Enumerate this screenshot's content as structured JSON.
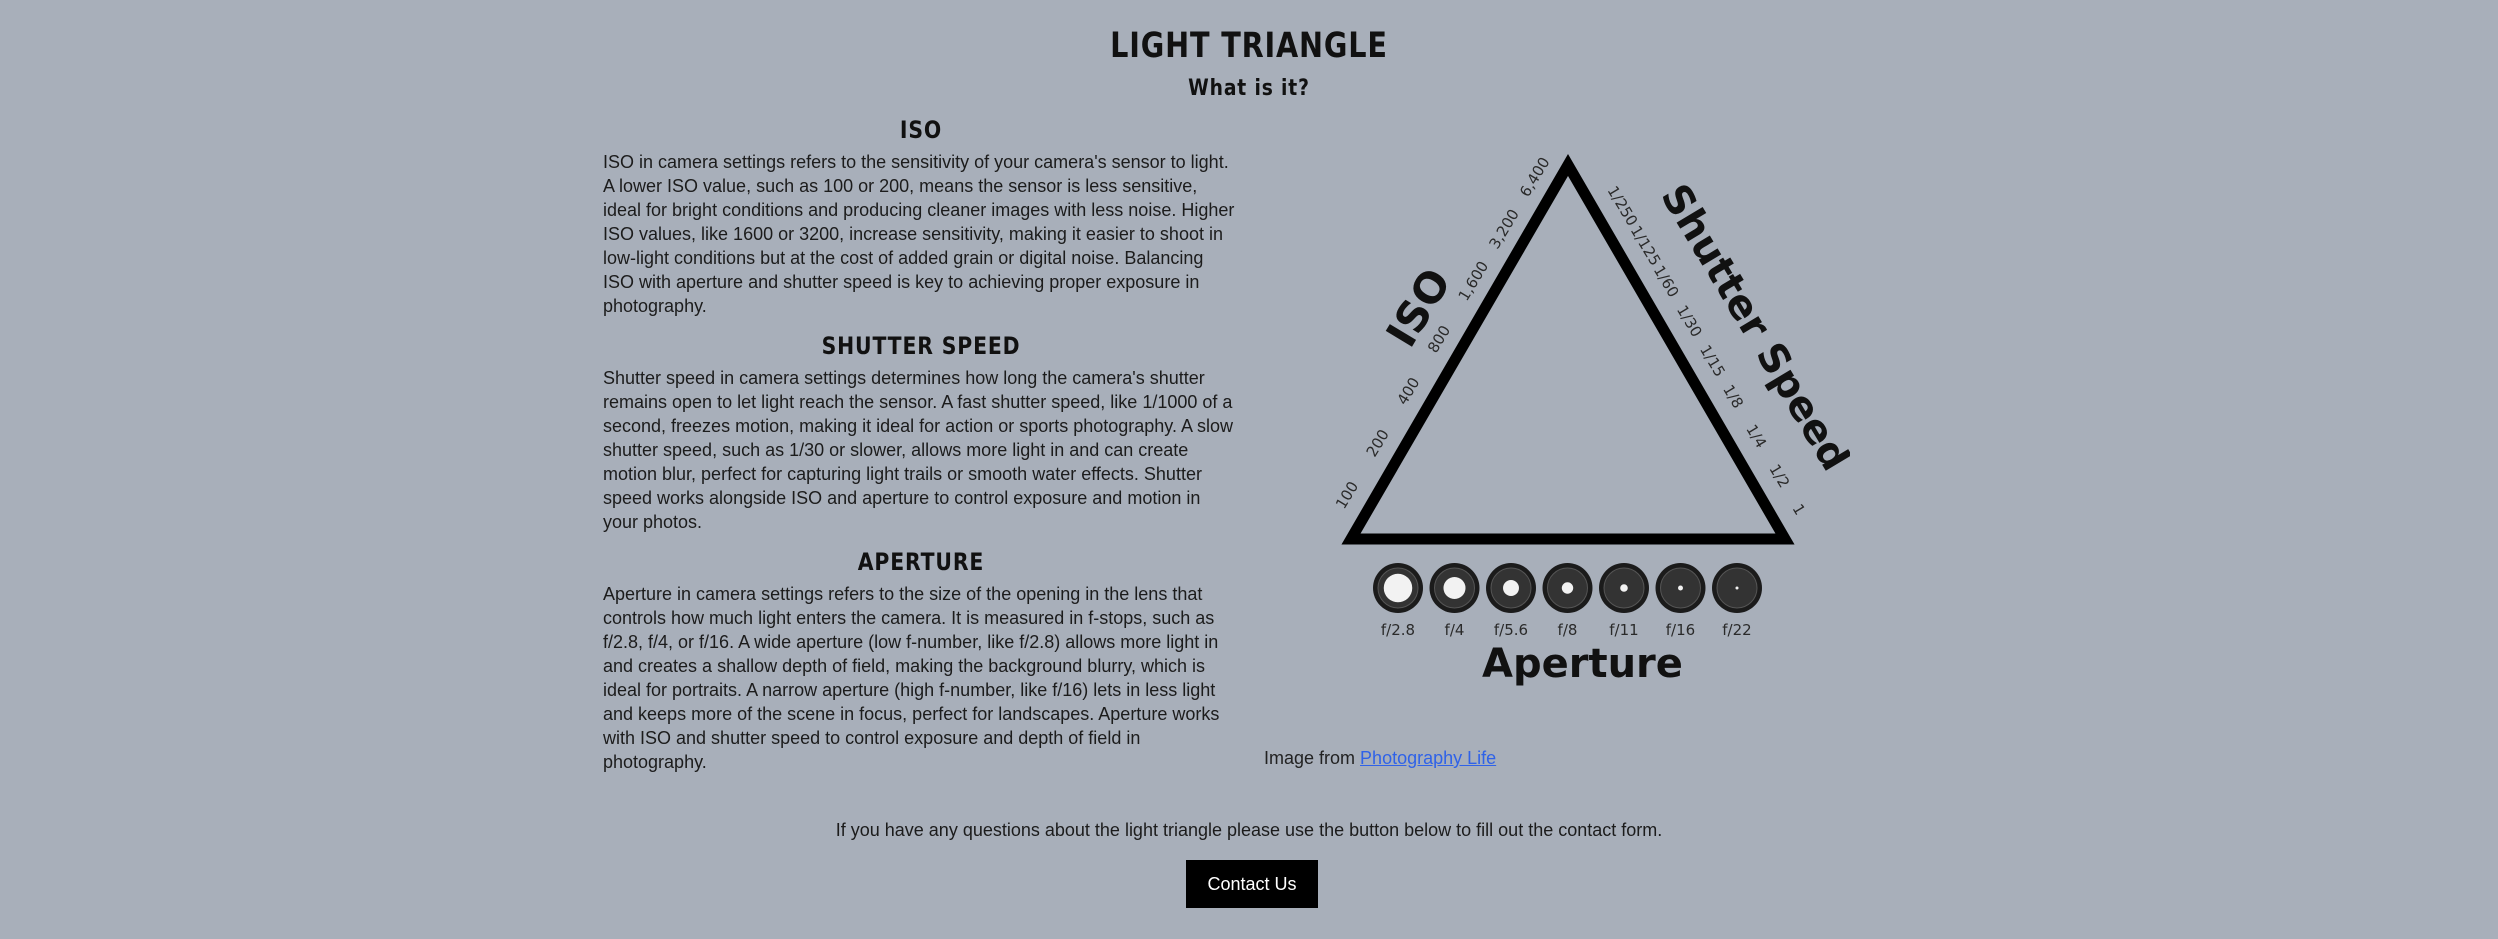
{
  "header": {
    "title": "LIGHT TRIANGLE",
    "subtitle": "What is it?"
  },
  "sections": [
    {
      "heading": "ISO",
      "body": "ISO in camera settings refers to the sensitivity of your camera's sensor to light. A lower ISO value, such as 100 or 200, means the sensor is less sensitive, ideal for bright conditions and producing cleaner images with less noise. Higher ISO values, like 1600 or 3200, increase sensitivity, making it easier to shoot in low-light conditions but at the cost of added grain or digital noise. Balancing ISO with aperture and shutter speed is key to achieving proper exposure in photography."
    },
    {
      "heading": "SHUTTER SPEED",
      "body": "Shutter speed in camera settings determines how long the camera's shutter remains open to let light reach the sensor. A fast shutter speed, like 1/1000 of a second, freezes motion, making it ideal for action or sports photography. A slow shutter speed, such as 1/30 or slower, allows more light in and can create motion blur, perfect for capturing light trails or smooth water effects. Shutter speed works alongside ISO and aperture to control exposure and motion in your photos."
    },
    {
      "heading": "APERTURE",
      "body": "Aperture in camera settings refers to the size of the opening in the lens that controls how much light enters the camera. It is measured in f-stops, such as f/2.8, f/4, or f/16. A wide aperture (low f-number, like f/2.8) allows more light in and creates a shallow depth of field, making the background blurry, which is ideal for portraits. A narrow aperture (high f-number, like f/16) lets in less light and keeps more of the scene in focus, perfect for landscapes. Aperture works with ISO and shutter speed to control exposure and depth of field in photography."
    }
  ],
  "figure": {
    "iso_label": "ISO",
    "shutter_label": "Shutter Speed",
    "aperture_label": "Aperture",
    "iso_values": [
      "100",
      "200",
      "400",
      "800",
      "1,600",
      "3,200",
      "6,400"
    ],
    "shutter_values": [
      "1/250",
      "1/125",
      "1/60",
      "1/30",
      "1/15",
      "1/8",
      "1/4",
      "1/2",
      "1"
    ],
    "aperture_values": [
      "f/2.8",
      "f/4",
      "f/5.6",
      "f/8",
      "f/11",
      "f/16",
      "f/22"
    ],
    "aperture_openings": [
      0.75,
      0.58,
      0.42,
      0.3,
      0.2,
      0.13,
      0.08
    ],
    "credit_prefix": "Image from",
    "credit_link": "Photography Life"
  },
  "footer": {
    "question": "If you have any questions about the light triangle please use the button below to fill out the contact form.",
    "contact_label": "Contact Us"
  },
  "colors": {
    "background": "#a8afba",
    "button": "#000000",
    "link": "#2f62e8"
  }
}
